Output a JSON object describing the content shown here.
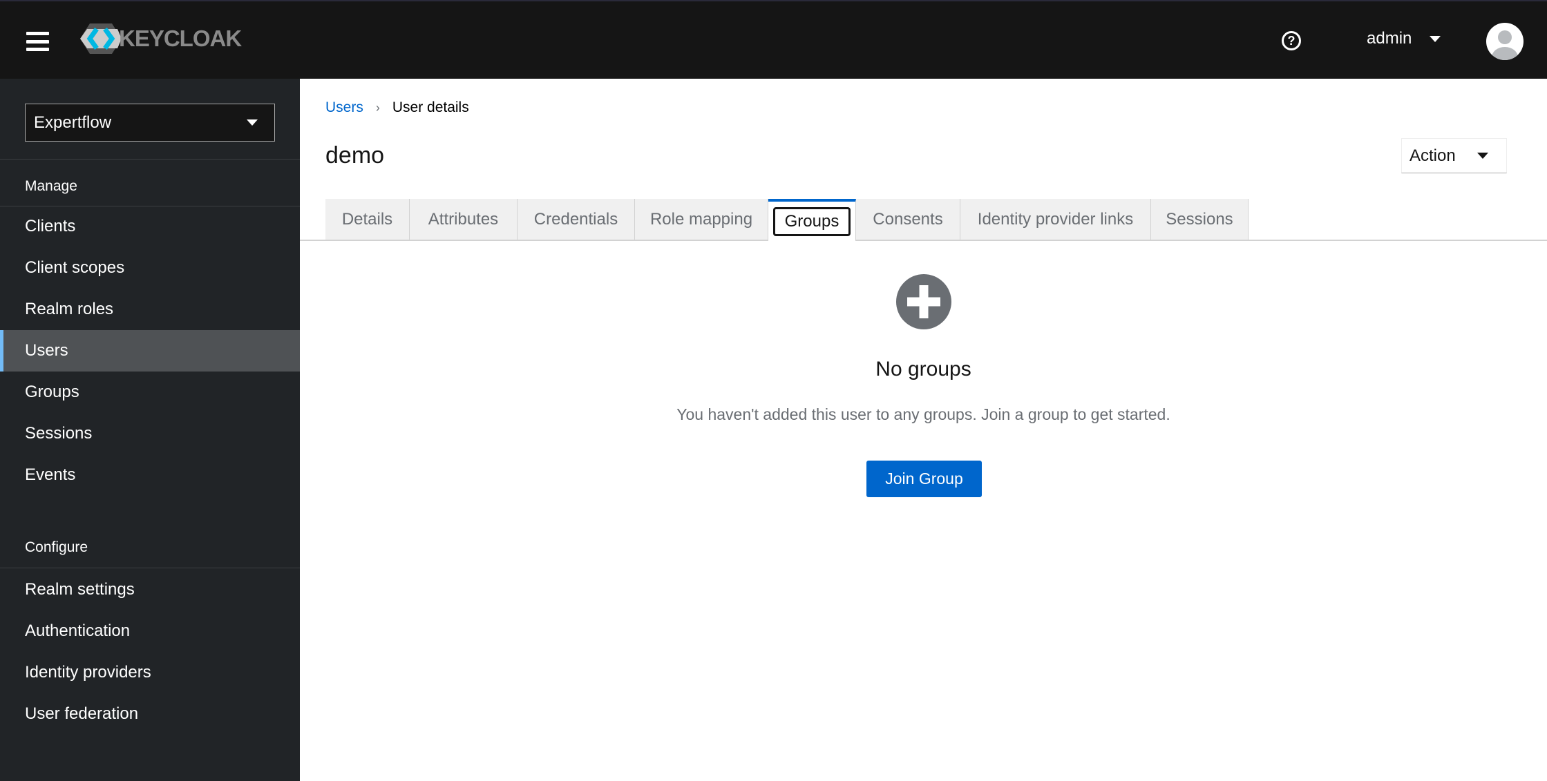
{
  "header": {
    "logo_text": "KEYCLOAK",
    "help_icon": "question-circle-icon",
    "username": "admin"
  },
  "sidebar": {
    "realm": "Expertflow",
    "manage_label": "Manage",
    "manage_items": [
      "Clients",
      "Client scopes",
      "Realm roles",
      "Users",
      "Groups",
      "Sessions",
      "Events"
    ],
    "active": "Users",
    "configure_label": "Configure",
    "configure_items": [
      "Realm settings",
      "Authentication",
      "Identity providers",
      "User federation"
    ]
  },
  "breadcrumb": {
    "parent": "Users",
    "current": "User details"
  },
  "page": {
    "title": "demo",
    "action_label": "Action"
  },
  "tabs": [
    "Details",
    "Attributes",
    "Credentials",
    "Role mapping",
    "Groups",
    "Consents",
    "Identity provider links",
    "Sessions"
  ],
  "active_tab": "Groups",
  "empty_state": {
    "icon": "plus-circle-icon",
    "title": "No groups",
    "description": "You haven't added this user to any groups. Join a group to get started.",
    "button": "Join Group"
  },
  "colors": {
    "accent": "#0066cc",
    "header_bg": "#151515",
    "sidebar_bg": "#212427"
  }
}
